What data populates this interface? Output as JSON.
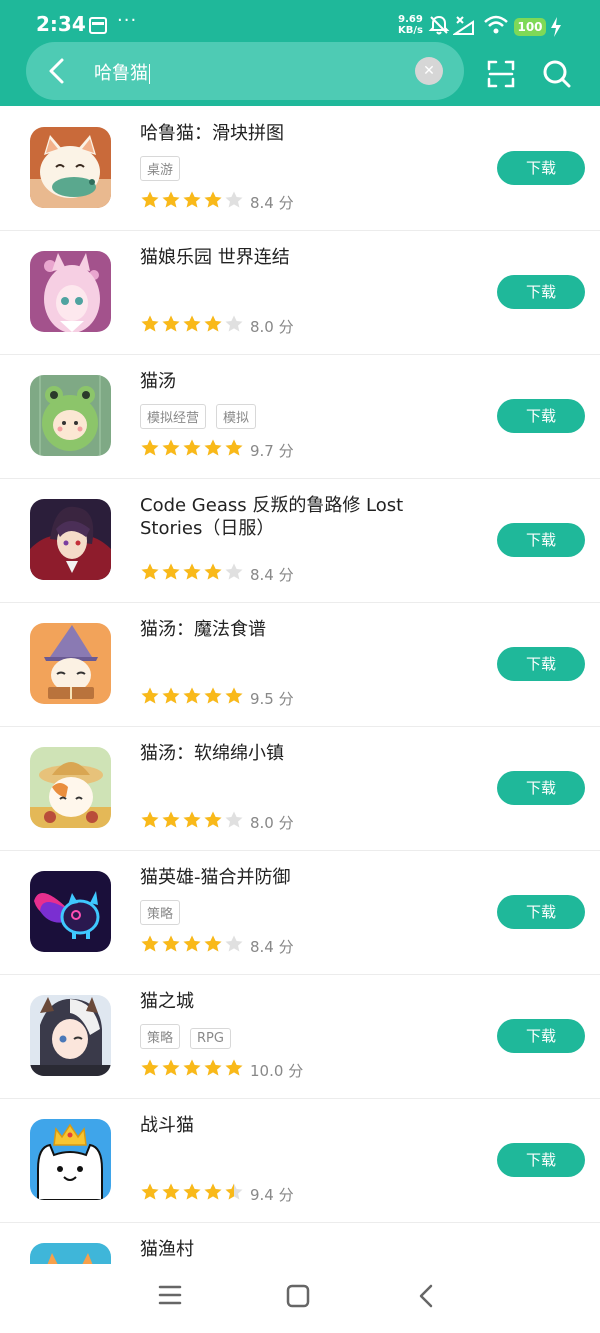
{
  "status_bar": {
    "time": "2:34",
    "dots": "···",
    "speed_top": "9.69",
    "speed_bottom": "KB/s",
    "battery": "100"
  },
  "search": {
    "query": "哈鲁猫"
  },
  "download_label": "下载",
  "score_unit": "分",
  "colors": {
    "accent": "#1fb89a",
    "star": "#f9b919",
    "star_empty": "#e0e0e0"
  },
  "results": [
    {
      "title": "哈鲁猫：滑块拼图",
      "tags": [
        "桌游"
      ],
      "stars": 4,
      "score": "8.4"
    },
    {
      "title": "猫娘乐园 世界连结",
      "tags": [],
      "stars": 4,
      "score": "8.0"
    },
    {
      "title": "猫汤",
      "tags": [
        "模拟经营",
        "模拟"
      ],
      "stars": 5,
      "score": "9.7"
    },
    {
      "title": "Code Geass 反叛的鲁路修 Lost Stories（日服）",
      "tags": [],
      "stars": 4,
      "score": "8.4"
    },
    {
      "title": "猫汤：魔法食谱",
      "tags": [],
      "stars": 5,
      "score": "9.5"
    },
    {
      "title": "猫汤：软绵绵小镇",
      "tags": [],
      "stars": 4,
      "score": "8.0"
    },
    {
      "title": "猫英雄-猫合并防御",
      "tags": [
        "策略"
      ],
      "stars": 4,
      "score": "8.4"
    },
    {
      "title": "猫之城",
      "tags": [
        "策略",
        "RPG"
      ],
      "stars": 5,
      "score": "10.0"
    },
    {
      "title": "战斗猫",
      "tags": [],
      "stars": 4.5,
      "score": "9.4"
    },
    {
      "title": "猫渔村",
      "tags": [],
      "stars": 0,
      "score": ""
    }
  ]
}
